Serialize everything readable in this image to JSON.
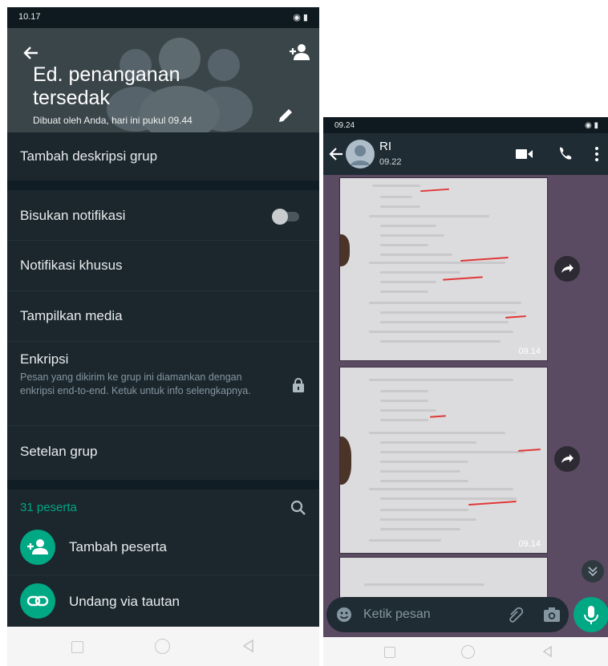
{
  "left": {
    "status_time": "10.17",
    "status_icons": "◉ ▮",
    "group": {
      "name": "Ed. penanganan tersedak",
      "created": "Dibuat oleh Anda, hari ini pukul 09.44"
    },
    "add_description": "Tambah deskripsi grup",
    "settings": {
      "mute": "Bisukan notifikasi",
      "custom_notif": "Notifikasi khusus",
      "media": "Tampilkan media",
      "encryption_title": "Enkripsi",
      "encryption_desc": "Pesan yang dikirim ke grup ini diamankan dengan enkripsi end-to-end. Ketuk untuk info selengkapnya.",
      "group_settings": "Setelan grup"
    },
    "participants": {
      "count_label": "31 peserta",
      "add": "Tambah peserta",
      "invite": "Undang via tautan"
    }
  },
  "right": {
    "status_time": "09.24",
    "status_icons": "◉ ▮",
    "contact": {
      "name": "RI",
      "last_seen": "09.22"
    },
    "messages": [
      {
        "time": "09.14"
      },
      {
        "time": "09.14"
      }
    ],
    "input_placeholder": "Ketik pesan"
  },
  "colors": {
    "accent": "#00a884",
    "dark_bg": "#101d25",
    "chat_bg": "#5a4a62"
  }
}
